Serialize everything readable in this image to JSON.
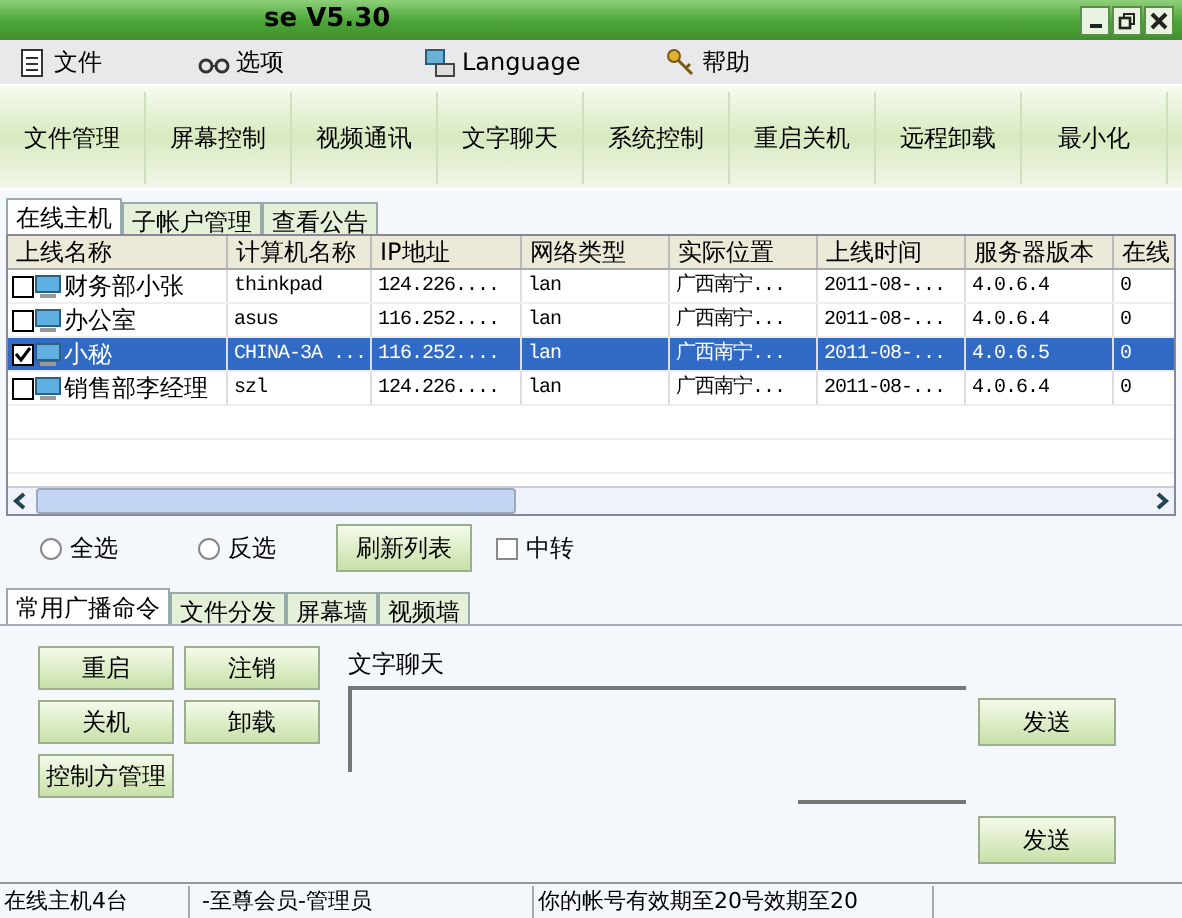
{
  "window": {
    "title": "se V5.30"
  },
  "menu": [
    {
      "label": "文件"
    },
    {
      "label": "选项"
    },
    {
      "label": "Language"
    },
    {
      "label": "帮助"
    }
  ],
  "toolbar": [
    "文件管理",
    "屏幕控制",
    "视频通讯",
    "文字聊天",
    "系统控制",
    "重启关机",
    "远程卸载",
    "最小化"
  ],
  "tabs": [
    {
      "label": "在线主机",
      "selected": true
    },
    {
      "label": "子帐户管理",
      "selected": false
    },
    {
      "label": "查看公告",
      "selected": false
    }
  ],
  "table": {
    "columns": [
      "上线名称",
      "计算机名称",
      "IP地址",
      "网络类型",
      "实际位置",
      "上线时间",
      "服务器版本",
      "在线"
    ],
    "rows": [
      {
        "checked": false,
        "selected": false,
        "cells": [
          "财务部小张",
          "thinkpad",
          "124.226....",
          "lan",
          "广西南宁...",
          "2011-08-...",
          "4.0.6.4",
          "0"
        ]
      },
      {
        "checked": false,
        "selected": false,
        "cells": [
          "办公室",
          "asus",
          "116.252....",
          "lan",
          "广西南宁...",
          "2011-08-...",
          "4.0.6.4",
          "0"
        ]
      },
      {
        "checked": true,
        "selected": true,
        "cells": [
          "小秘",
          "CHINA-3A ...",
          "116.252....",
          "lan",
          "广西南宁...",
          "2011-08-...",
          "4.0.6.5",
          "0"
        ]
      },
      {
        "checked": false,
        "selected": false,
        "cells": [
          "销售部李经理",
          "szl",
          "124.226....",
          "lan",
          "广西南宁...",
          "2011-08-...",
          "4.0.6.4",
          "0"
        ]
      }
    ]
  },
  "options": [
    {
      "kind": "radio",
      "label": "全选",
      "checked": false
    },
    {
      "kind": "radio",
      "label": "反选",
      "checked": false
    },
    {
      "kind": "button",
      "label": "刷新列表"
    },
    {
      "kind": "checkbox",
      "label": "中转",
      "checked": false
    }
  ],
  "lower_tabs": [
    {
      "label": "常用广播命令",
      "selected": true
    },
    {
      "label": "文件分发",
      "selected": false
    },
    {
      "label": "屏幕墙",
      "selected": false
    },
    {
      "label": "视频墙",
      "selected": false
    }
  ],
  "commands": [
    "重启",
    "注销",
    "关机",
    "卸载",
    "控制方管理"
  ],
  "chat": {
    "label": "文字聊天",
    "send_buttons": [
      "发送",
      "发送"
    ]
  },
  "status_bar": [
    "在线主机4台",
    "-至尊会员-管理员",
    "你的帐号有效期至20号效期至20"
  ]
}
